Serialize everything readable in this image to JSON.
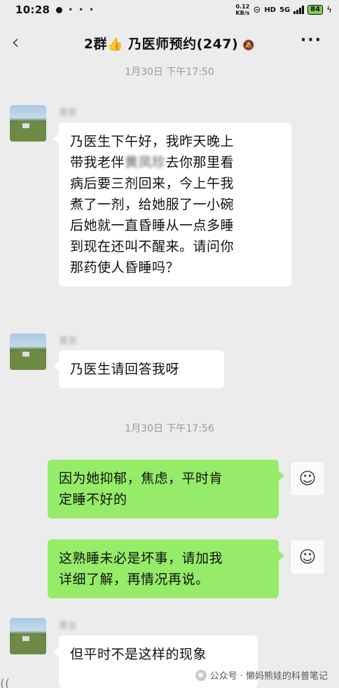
{
  "status_bar": {
    "time": "10:28",
    "more_dots": "• • •",
    "net_speed_value": "0.12",
    "net_speed_unit": "KB/s",
    "hd_label": "HD",
    "network": "5G",
    "battery": "84"
  },
  "header": {
    "back_icon": "‹",
    "title_prefix": "2群",
    "title_emoji": "👍",
    "title_rest": " 乃医师预约(247)",
    "mute_icon": "🔕",
    "menu_icon": "···"
  },
  "messages": {
    "ts1": "1月30日 下午17:50",
    "ts2": "1月30日 下午17:56",
    "m1": {
      "sender": "黄家",
      "line1": "乃医生下午好，我昨天晚上",
      "line2_a": "带我老伴",
      "line2_blur": "黄凤珍",
      "line2_b": "去你那里看",
      "line3": "病后要三剂回来，今上午我",
      "line4": "煮了一剂，给她服了一小碗",
      "line5": "后她就一直昏睡从一点多睡",
      "line6": "到现在还叫不醒来。请问你",
      "line7": "那药使人昏睡吗？"
    },
    "m2": {
      "sender": "黄家",
      "text": "乃医生请回答我呀"
    },
    "m3": {
      "line1": "因为她抑郁，焦虑，平时肯",
      "line2": "定睡不好的"
    },
    "m4": {
      "line1": "这熟睡未必是坏事，请加我",
      "line2": "详细了解，再情况再说。"
    },
    "m5": {
      "sender": "黄友",
      "text": "但平时不是这样的现象"
    },
    "doctor_avatar_glyph": "☺"
  },
  "watermark": {
    "text": "公众号 · 懒妈熊娃的科普笔记",
    "icon": "◉"
  },
  "bottom_hint": "(("
}
